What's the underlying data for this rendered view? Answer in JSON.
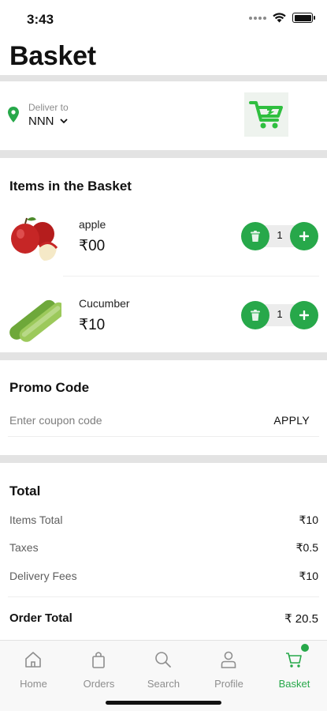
{
  "status_bar": {
    "time": "3:43"
  },
  "header": {
    "title": "Basket"
  },
  "delivery": {
    "label": "Deliver to",
    "value": "NNN"
  },
  "basket": {
    "title": "Items in the Basket",
    "items": [
      {
        "name": "apple",
        "price": "₹00",
        "quantity": "1",
        "image": "apples-image"
      },
      {
        "name": "Cucumber",
        "price": "₹10",
        "quantity": "1",
        "image": "cucumber-image"
      }
    ]
  },
  "promo": {
    "title": "Promo Code",
    "placeholder": "Enter coupon code",
    "apply_label": "APPLY"
  },
  "totals": {
    "title": "Total",
    "rows": [
      {
        "label": "Items Total",
        "value": "₹10"
      },
      {
        "label": "Taxes",
        "value": "₹0.5"
      },
      {
        "label": "Delivery Fees",
        "value": "₹10"
      }
    ],
    "order_total_label": "Order Total",
    "order_total_value": "₹ 20.5"
  },
  "tab_bar": {
    "active": "Basket",
    "tabs": [
      {
        "label": "Home",
        "icon": "home-icon"
      },
      {
        "label": "Orders",
        "icon": "bag-icon"
      },
      {
        "label": "Search",
        "icon": "search-icon"
      },
      {
        "label": "Profile",
        "icon": "profile-icon"
      },
      {
        "label": "Basket",
        "icon": "cart-icon"
      }
    ]
  },
  "colors": {
    "accent": "#27a84a",
    "separator": "#e3e3e3",
    "muted_text": "#8c8c8c"
  }
}
